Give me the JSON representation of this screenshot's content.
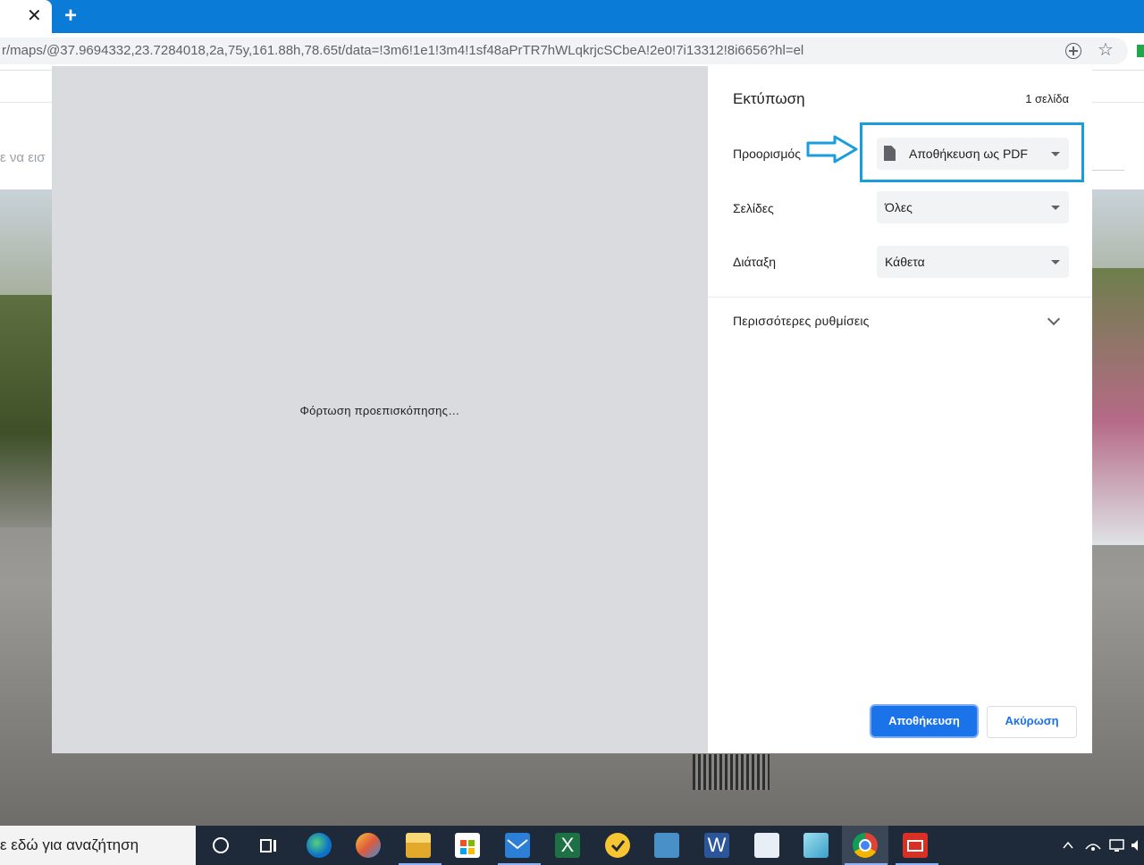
{
  "browser": {
    "tab_close_glyph": "✕",
    "new_tab_glyph": "+",
    "url": "r/maps/@37.9694332,23.7284018,2a,75y,161.88h,78.65t/data=!3m6!1e1!3m4!1sf48aPrTR7hWLqkrjcSCbeA!2e0!7i13312!8i6656?hl=el",
    "star_glyph": "☆"
  },
  "page_behind": {
    "search_fragment": "ε να εισ"
  },
  "print_dialog": {
    "preview_loading": "Φόρτωση προεπισκόπησης…",
    "title": "Εκτύπωση",
    "page_count": "1 σελίδα",
    "destination": {
      "label": "Προορισμός",
      "value": "Αποθήκευση ως PDF",
      "icon": "document-icon"
    },
    "pages": {
      "label": "Σελίδες",
      "value": "Όλες"
    },
    "layout": {
      "label": "Διάταξη",
      "value": "Κάθετα"
    },
    "more_settings": "Περισσότερες ρυθμίσεις",
    "save_button": "Αποθήκευση",
    "cancel_button": "Ακύρωση",
    "accent_color": "#1a73e8",
    "annotation_color": "#1a9ddc"
  },
  "taskbar": {
    "search_text": "ε εδώ για αναζήτηση",
    "apps": [
      "cortana-circle-icon",
      "task-view-icon",
      "edge-icon",
      "paint-icon",
      "file-explorer-icon",
      "store-icon",
      "mail-icon",
      "excel-icon",
      "norton-icon",
      "keyboard-app-icon",
      "word-icon",
      "publisher-icon",
      "notes-icon",
      "chrome-icon",
      "news-app-icon"
    ],
    "tray": [
      "chevron-up-icon",
      "network-icon",
      "display-icon",
      "volume-icon"
    ]
  }
}
